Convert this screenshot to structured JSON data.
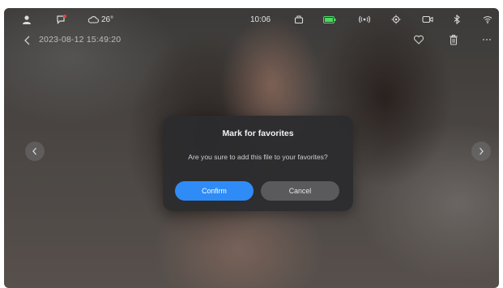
{
  "status_bar": {
    "temperature": "26°",
    "time": "10:06",
    "battery_color": "#4cd964",
    "icons": [
      "user-icon",
      "message-alert-icon",
      "weather-cloud-icon",
      "box-icon",
      "battery-icon",
      "hotspot-icon",
      "location-icon",
      "camera-icon",
      "bluetooth-icon",
      "wifi-icon"
    ]
  },
  "header": {
    "datetime": "2023-08-12 15:49:20",
    "icons": [
      "back-arrow-icon",
      "heart-icon",
      "trash-icon",
      "more-icon"
    ]
  },
  "dialog": {
    "title": "Mark for favorites",
    "message": "Are you sure to add this file to your favorites?",
    "confirm_label": "Confirm",
    "cancel_label": "Cancel",
    "accent_color": "#2f8cf7"
  }
}
